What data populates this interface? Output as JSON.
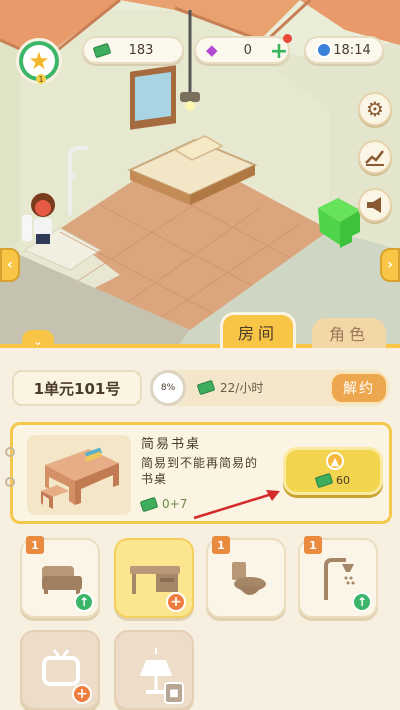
{
  "hud": {
    "cash": "183",
    "gems": "0",
    "time": "18:14",
    "level": "1"
  },
  "tabs": {
    "rooms": "房间",
    "characters": "角色"
  },
  "room": {
    "name": "1单元101号",
    "progress_percent": "8%",
    "progress_value": 0.08,
    "income": "22/小时",
    "terminate_button": "解约"
  },
  "item": {
    "title": "简易书桌",
    "description": "简易到不能再简易的书桌",
    "bonus": "0+7",
    "upgrade_cost": "60"
  },
  "slots": [
    {
      "name": "bed",
      "badge": "1",
      "action": "upgrade"
    },
    {
      "name": "desk",
      "badge": "",
      "action": "add"
    },
    {
      "name": "toilet",
      "badge": "1",
      "action": "none"
    },
    {
      "name": "shower",
      "badge": "1",
      "action": "upgrade"
    },
    {
      "name": "tv",
      "badge": "",
      "action": "add"
    },
    {
      "name": "lamp",
      "badge": "",
      "action": "locked"
    }
  ],
  "colors": {
    "accent_yellow": "#f8c547",
    "green": "#3bb56a",
    "panel_bg": "#f7efe0",
    "terminate": "#eda84f"
  }
}
